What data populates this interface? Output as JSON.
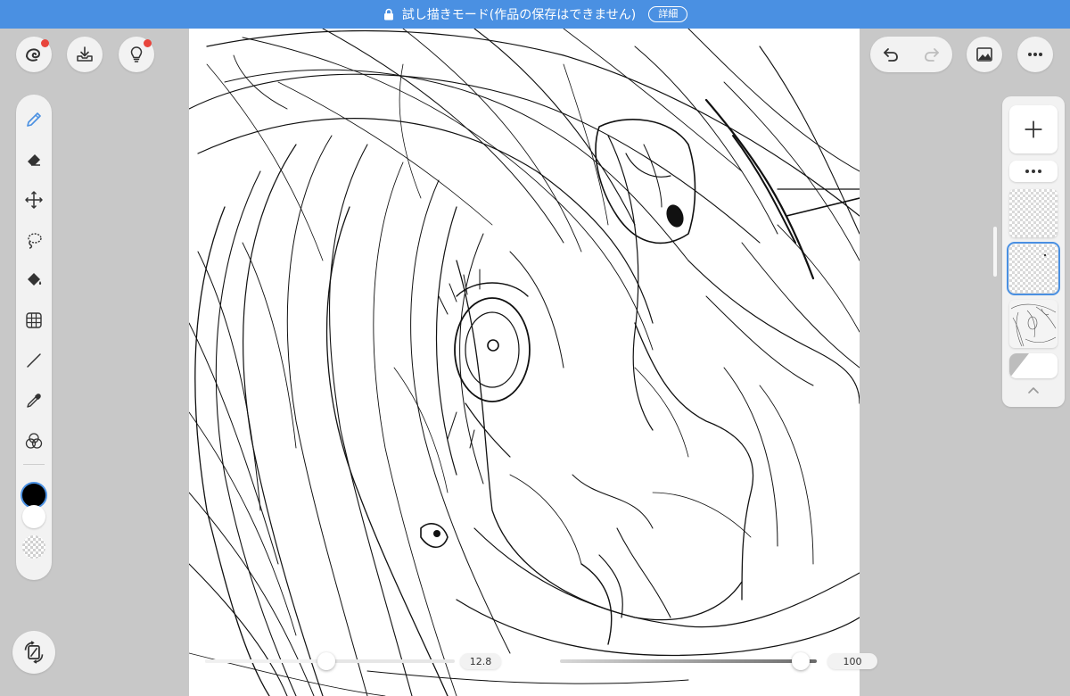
{
  "banner": {
    "text": "試し描きモード(作品の保存はできません)",
    "detail_label": "詳細",
    "background": "#4a90e2"
  },
  "top_left_buttons": [
    {
      "name": "app-menu",
      "icon": "swirl-logo-icon",
      "badge": true
    },
    {
      "name": "download",
      "icon": "download-tray-icon",
      "badge": false
    },
    {
      "name": "tips",
      "icon": "lightbulb-icon",
      "badge": true
    }
  ],
  "top_right_buttons": [
    {
      "name": "undo",
      "icon": "undo-icon"
    },
    {
      "name": "redo",
      "icon": "redo-icon"
    },
    {
      "name": "gallery",
      "icon": "image-icon"
    },
    {
      "name": "more",
      "icon": "more-horizontal-icon"
    }
  ],
  "tools": [
    {
      "name": "pen",
      "icon": "pen-icon",
      "selected": true
    },
    {
      "name": "eraser",
      "icon": "eraser-icon"
    },
    {
      "name": "move",
      "icon": "move-arrows-icon"
    },
    {
      "name": "lasso",
      "icon": "lasso-icon"
    },
    {
      "name": "fill",
      "icon": "paint-bucket-icon"
    },
    {
      "name": "transform",
      "icon": "grid-transform-icon"
    },
    {
      "name": "line",
      "icon": "line-icon"
    },
    {
      "name": "eyedropper",
      "icon": "eyedropper-icon"
    },
    {
      "name": "color-blend",
      "icon": "color-circles-icon"
    }
  ],
  "colors": {
    "primary": "#000000",
    "secondary": "#ffffff",
    "accent": "#4a90e2",
    "badge": "#e8453c"
  },
  "brush_size": {
    "value": "12.8",
    "fraction": 0.27
  },
  "opacity": {
    "value": "100",
    "fraction": 1.0
  },
  "layers": {
    "add_icon": "plus-icon",
    "more_icon": "more-horizontal-icon",
    "items": [
      {
        "name": "layer-empty",
        "selected": false
      },
      {
        "name": "layer-current",
        "selected": true
      },
      {
        "name": "layer-sketch",
        "selected": false
      }
    ],
    "background_layer": "paper-icon",
    "collapse_icon": "chevron-up-icon"
  },
  "bottom_left_button": {
    "icon": "rotate-canvas-icon"
  }
}
